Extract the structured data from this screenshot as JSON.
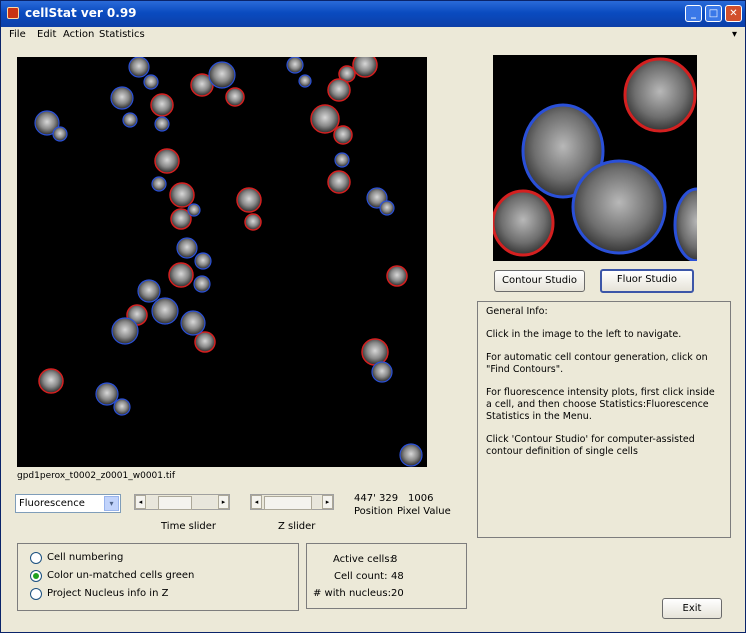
{
  "window": {
    "title": "cellStat ver 0.99",
    "minimize": "_",
    "maximize": "□",
    "close": "✕"
  },
  "menu": {
    "items": [
      "File",
      "Edit",
      "Action",
      "Statistics"
    ],
    "overflow_arrow": "▾"
  },
  "main_image": {
    "filename": "gpd1perox_t0002_z0001_w0001.tif"
  },
  "controls": {
    "channel_select": {
      "selected": "Fluorescence",
      "arrow": "▾"
    },
    "time_slider_label": "Time slider",
    "z_slider_label": "Z slider",
    "slider_left": "◂",
    "slider_right": "▸",
    "time_slider_value": 0.3,
    "z_slider_value": 0.12,
    "position_value": "447' 329",
    "position_label": "Position",
    "pixel_value": "1006",
    "pixel_label": "Pixel Value"
  },
  "buttons": {
    "contour_studio": "Contour Studio",
    "fluor_studio": "Fluor Studio",
    "exit": "Exit"
  },
  "info": {
    "heading": "General Info:",
    "lines": [
      "Click in the image to the left to navigate.",
      "For automatic cell contour generation, click on \"Find Contours\".",
      "For fluorescence intensity plots, first click inside a cell, and then choose Statistics:Fluorescence Statistics in the Menu.",
      "Click 'Contour Studio' for computer-assisted contour definition of single cells"
    ]
  },
  "options": {
    "radios": [
      {
        "label": "Cell numbering",
        "checked": false
      },
      {
        "label": "Color un-matched cells green",
        "checked": true
      },
      {
        "label": "Project Nucleus info in Z",
        "checked": false
      }
    ]
  },
  "stats": {
    "active_label": "Active cells:",
    "active_value": "8",
    "count_label": "Cell count:",
    "count_value": "48",
    "nucleus_label": "# with nucleus:",
    "nucleus_value": "20"
  },
  "colors": {
    "contour_red": "#d42020",
    "contour_blue": "#2a50d8",
    "titlebar": "#0a4bc0"
  }
}
